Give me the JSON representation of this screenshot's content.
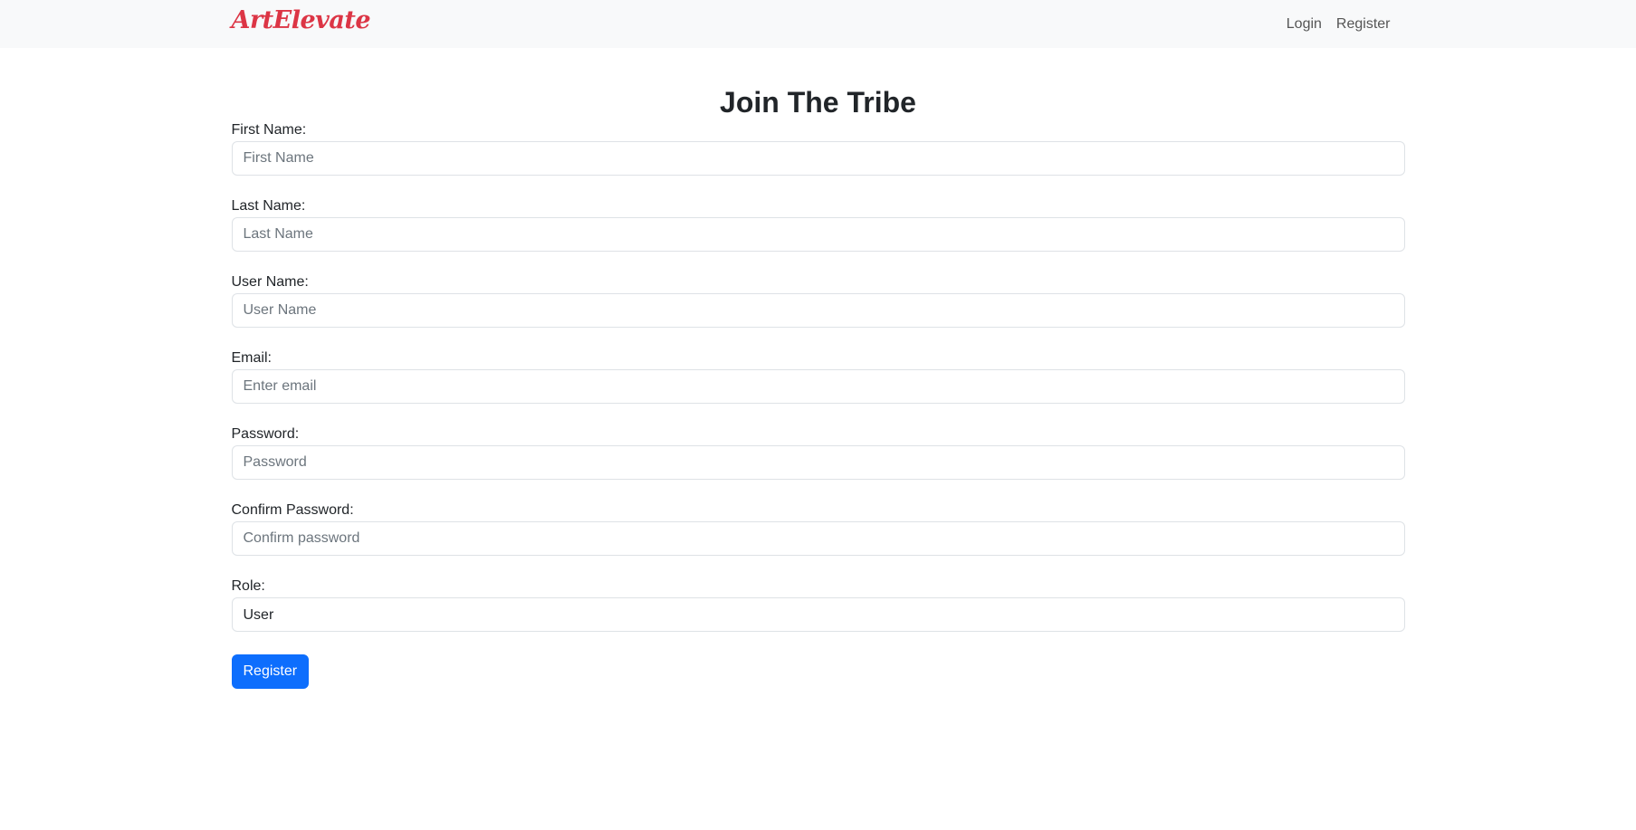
{
  "navbar": {
    "brand": "ArtElevate",
    "links": [
      {
        "label": "Login"
      },
      {
        "label": "Register"
      }
    ]
  },
  "page": {
    "title": "Join The Tribe"
  },
  "form": {
    "fields": [
      {
        "label": "First Name:",
        "placeholder": "First Name",
        "value": ""
      },
      {
        "label": "Last Name:",
        "placeholder": "Last Name",
        "value": ""
      },
      {
        "label": "User Name:",
        "placeholder": "User Name",
        "value": ""
      },
      {
        "label": "Email:",
        "placeholder": "Enter email",
        "value": ""
      },
      {
        "label": "Password:",
        "placeholder": "Password",
        "value": ""
      },
      {
        "label": "Confirm Password:",
        "placeholder": "Confirm password",
        "value": ""
      }
    ],
    "role": {
      "label": "Role:",
      "selected": "User"
    },
    "submit_label": "Register"
  },
  "colors": {
    "brand": "#dc3545",
    "primary": "#0d6efd",
    "navbar_bg": "#f8f9fa"
  }
}
